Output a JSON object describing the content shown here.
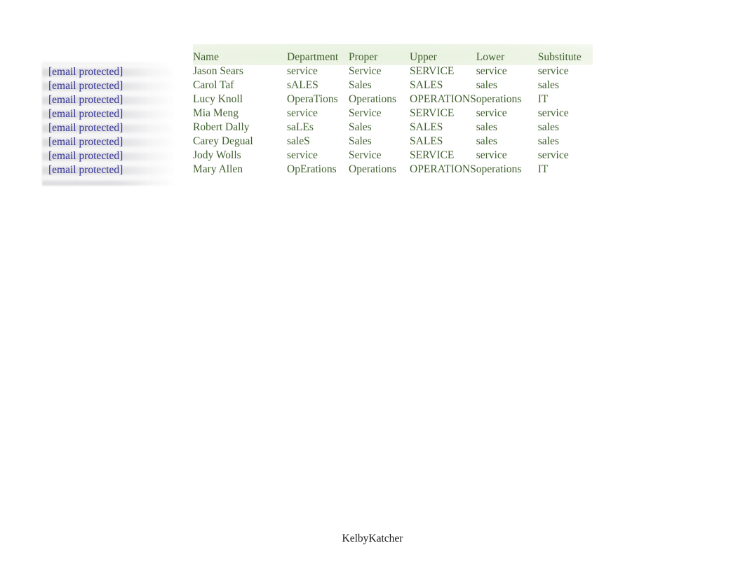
{
  "page": {
    "background_color": "#ffffff",
    "footer_text": "KelbyKatcher"
  },
  "colors": {
    "table_text": "#41602f",
    "header_band": "#e7f0dd",
    "email_link": "#333399",
    "footer_text": "#1b1b1b"
  },
  "email_column": {
    "name": "contact-email-column",
    "items": [
      {
        "label": "[email protected]"
      },
      {
        "label": "[email protected]"
      },
      {
        "label": "[email protected]"
      },
      {
        "label": "[email protected]"
      },
      {
        "label": "[email protected]"
      },
      {
        "label": "[email protected]"
      },
      {
        "label": "[email protected]"
      },
      {
        "label": "[email protected]"
      }
    ]
  },
  "table": {
    "columns": [
      {
        "key": "name",
        "label": "Name"
      },
      {
        "key": "department",
        "label": "Department"
      },
      {
        "key": "proper",
        "label": "Proper"
      },
      {
        "key": "upper",
        "label": "Upper"
      },
      {
        "key": "lower",
        "label": "Lower"
      },
      {
        "key": "substitute",
        "label": "Substitute"
      }
    ],
    "rows": [
      {
        "name": "Jason Sears",
        "department": "service",
        "proper": "Service",
        "upper": "SERVICE",
        "lower": "service",
        "substitute": "service"
      },
      {
        "name": "Carol Taf",
        "department": "sALES",
        "proper": "Sales",
        "upper": "SALES",
        "lower": "sales",
        "substitute": "sales"
      },
      {
        "name": "Lucy Knoll",
        "department": "OperaTions",
        "proper": "Operations",
        "upper": "OPERATIONS",
        "lower": "operations",
        "substitute": "IT"
      },
      {
        "name": "Mia Meng",
        "department": "service",
        "proper": "Service",
        "upper": "SERVICE",
        "lower": "service",
        "substitute": "service"
      },
      {
        "name": "Robert Dally",
        "department": "saLEs",
        "proper": "Sales",
        "upper": "SALES",
        "lower": "sales",
        "substitute": "sales"
      },
      {
        "name": "Carey Degual",
        "department": "saleS",
        "proper": "Sales",
        "upper": "SALES",
        "lower": "sales",
        "substitute": "sales"
      },
      {
        "name": "Jody Wolls",
        "department": "service",
        "proper": "Service",
        "upper": "SERVICE",
        "lower": "service",
        "substitute": "service"
      },
      {
        "name": "Mary Allen",
        "department": "OpErations",
        "proper": "Operations",
        "upper": "OPERATIONS",
        "lower": "operations",
        "substitute": "IT"
      }
    ]
  }
}
